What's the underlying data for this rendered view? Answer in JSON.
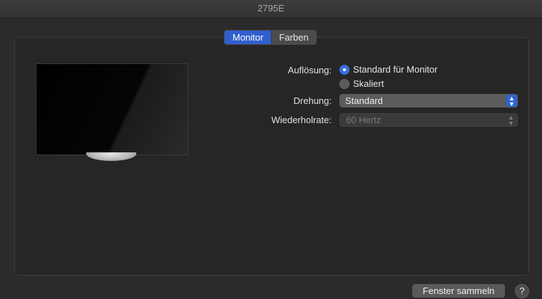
{
  "window": {
    "title": "2795E"
  },
  "tabs": [
    {
      "label": "Monitor",
      "active": true
    },
    {
      "label": "Farben",
      "active": false
    }
  ],
  "settings": {
    "resolution": {
      "label": "Auflösung:",
      "options": [
        {
          "label": "Standard für Monitor",
          "selected": true
        },
        {
          "label": "Skaliert",
          "selected": false
        }
      ]
    },
    "rotation": {
      "label": "Drehung:",
      "value": "Standard"
    },
    "refresh_rate": {
      "label": "Wiederholrate:",
      "value": "60 Hertz",
      "disabled": true
    }
  },
  "footer": {
    "gather_windows_label": "Fenster sammeln",
    "help_label": "?"
  },
  "colors": {
    "accent": "#2f5fcf",
    "background": "#2b2b2b"
  }
}
